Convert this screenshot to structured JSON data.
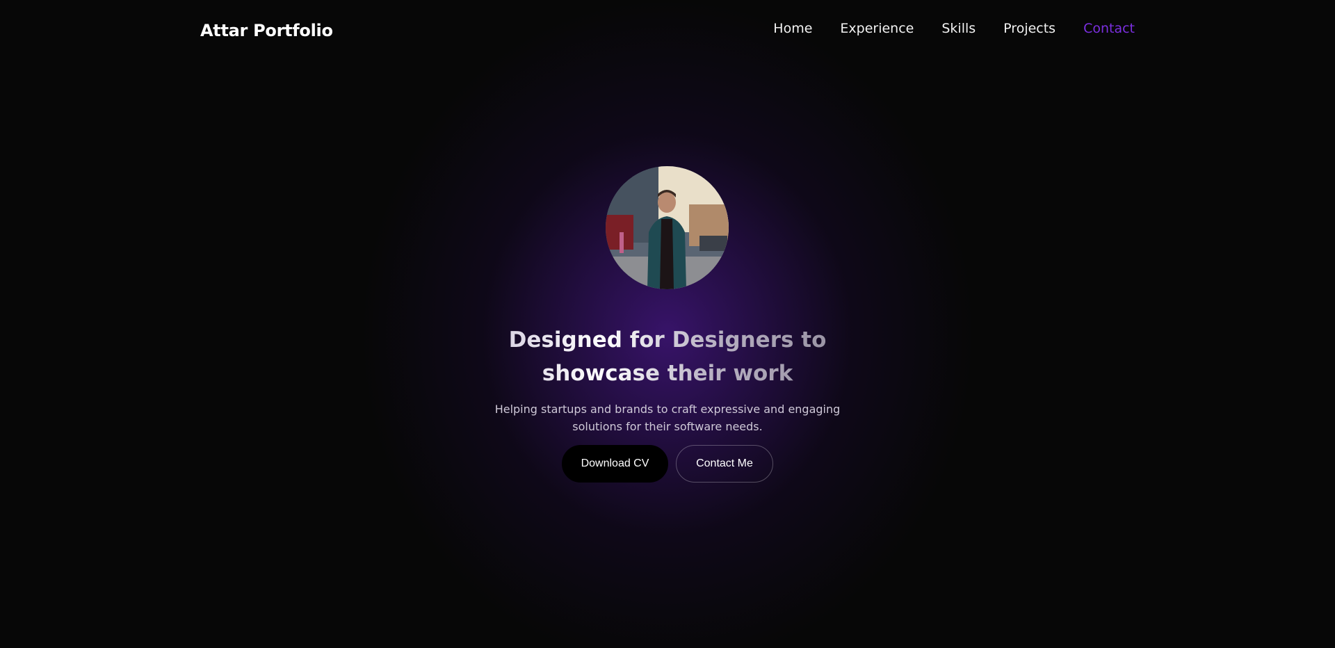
{
  "header": {
    "brand": "Attar Portfolio",
    "nav": [
      {
        "label": "Home",
        "active": false
      },
      {
        "label": "Experience",
        "active": false
      },
      {
        "label": "Skills",
        "active": false
      },
      {
        "label": "Projects",
        "active": false
      },
      {
        "label": "Contact",
        "active": true
      }
    ]
  },
  "hero": {
    "headline_line1": "Designed for Designers to",
    "headline_line2": "showcase their work",
    "subtext_line1": "Helping startups and brands to craft expressive and engaging",
    "subtext_line2": "solutions for their software needs.",
    "primary_button": "Download CV",
    "secondary_button": "Contact Me"
  },
  "colors": {
    "background": "#070707",
    "glow": "#3a146e",
    "accent": "#7b2fe0",
    "text": "#ffffff"
  },
  "icons": {
    "avatar": "profile-photo"
  }
}
